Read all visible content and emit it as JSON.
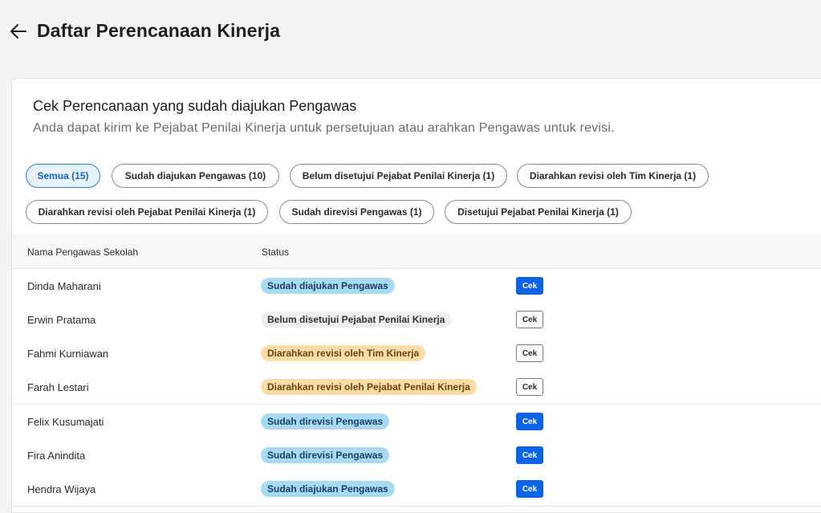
{
  "header": {
    "back_icon": "arrow-left-icon",
    "title": "Daftar Perencanaan Kinerja"
  },
  "card": {
    "title": "Cek Perencanaan yang sudah diajukan Pengawas",
    "subtitle": "Anda dapat kirim ke Pejabat Penilai Kinerja untuk persetujuan atau arahkan Pengawas untuk revisi."
  },
  "filters": [
    {
      "label": "Semua (15)",
      "active": true
    },
    {
      "label": "Sudah diajukan Pengawas (10)",
      "active": false
    },
    {
      "label": "Belum disetujui Pejabat Penilai Kinerja (1)",
      "active": false
    },
    {
      "label": "Diarahkan revisi oleh Tim Kinerja (1)",
      "active": false
    },
    {
      "label": "Diarahkan revisi oleh Pejabat Penilai Kinerja (1)",
      "active": false
    },
    {
      "label": "Sudah direvisi Pengawas (1)",
      "active": false
    },
    {
      "label": "Disetujui Pejabat Penilai Kinerja (1)",
      "active": false
    }
  ],
  "table": {
    "columns": [
      "Nama Pengawas Sekolah",
      "Status"
    ],
    "action_label": "Cek",
    "rows": [
      {
        "name": "Dinda Maharani",
        "status": "Sudah diajukan Pengawas",
        "status_color": "blue",
        "action_style": "primary"
      },
      {
        "name": "Erwin Pratama",
        "status": "Belum disetujui Pejabat Penilai Kinerja",
        "status_color": "gray",
        "action_style": "outline"
      },
      {
        "name": "Fahmi Kurniawan",
        "status": "Diarahkan revisi oleh Tim Kinerja",
        "status_color": "orange",
        "action_style": "outline"
      },
      {
        "name": "Farah Lestari",
        "status": "Diarahkan revisi oleh Pejabat Penilai Kinerja",
        "status_color": "orange",
        "action_style": "outline"
      },
      {
        "name": "Felix Kusumajati",
        "status": "Sudah direvisi Pengawas",
        "status_color": "blue",
        "action_style": "primary"
      },
      {
        "name": "Fira Anindita",
        "status": "Sudah direvisi Pengawas",
        "status_color": "blue",
        "action_style": "primary"
      },
      {
        "name": "Hendra Wijaya",
        "status": "Sudah diajukan Pengawas",
        "status_color": "blue",
        "action_style": "primary"
      }
    ]
  },
  "colors": {
    "primary": "#0b63e5",
    "badge_blue": "#a8daf4",
    "badge_orange": "#fbdca6",
    "badge_gray": "#efefef"
  }
}
